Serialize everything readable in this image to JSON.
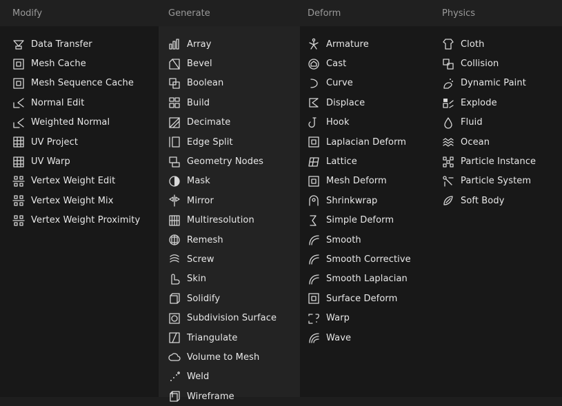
{
  "columns": [
    {
      "title": "Modify",
      "items": [
        {
          "label": "Data Transfer",
          "icon": "data-transfer-icon"
        },
        {
          "label": "Mesh Cache",
          "icon": "mesh-cache-icon"
        },
        {
          "label": "Mesh Sequence Cache",
          "icon": "mesh-sequence-cache-icon"
        },
        {
          "label": "Normal Edit",
          "icon": "normal-edit-icon"
        },
        {
          "label": "Weighted Normal",
          "icon": "weighted-normal-icon"
        },
        {
          "label": "UV Project",
          "icon": "uv-project-icon"
        },
        {
          "label": "UV Warp",
          "icon": "uv-warp-icon"
        },
        {
          "label": "Vertex Weight Edit",
          "icon": "vertex-weight-edit-icon"
        },
        {
          "label": "Vertex Weight Mix",
          "icon": "vertex-weight-mix-icon"
        },
        {
          "label": "Vertex Weight Proximity",
          "icon": "vertex-weight-proximity-icon"
        }
      ]
    },
    {
      "title": "Generate",
      "items": [
        {
          "label": "Array",
          "icon": "array-icon"
        },
        {
          "label": "Bevel",
          "icon": "bevel-icon"
        },
        {
          "label": "Boolean",
          "icon": "boolean-icon"
        },
        {
          "label": "Build",
          "icon": "build-icon"
        },
        {
          "label": "Decimate",
          "icon": "decimate-icon"
        },
        {
          "label": "Edge Split",
          "icon": "edge-split-icon"
        },
        {
          "label": "Geometry Nodes",
          "icon": "geometry-nodes-icon"
        },
        {
          "label": "Mask",
          "icon": "mask-icon"
        },
        {
          "label": "Mirror",
          "icon": "mirror-icon"
        },
        {
          "label": "Multiresolution",
          "icon": "multiresolution-icon"
        },
        {
          "label": "Remesh",
          "icon": "remesh-icon"
        },
        {
          "label": "Screw",
          "icon": "screw-icon"
        },
        {
          "label": "Skin",
          "icon": "skin-icon"
        },
        {
          "label": "Solidify",
          "icon": "solidify-icon"
        },
        {
          "label": "Subdivision Surface",
          "icon": "subdivision-surface-icon"
        },
        {
          "label": "Triangulate",
          "icon": "triangulate-icon"
        },
        {
          "label": "Volume to Mesh",
          "icon": "volume-to-mesh-icon"
        },
        {
          "label": "Weld",
          "icon": "weld-icon"
        },
        {
          "label": "Wireframe",
          "icon": "wireframe-icon"
        }
      ]
    },
    {
      "title": "Deform",
      "items": [
        {
          "label": "Armature",
          "icon": "armature-icon"
        },
        {
          "label": "Cast",
          "icon": "cast-icon"
        },
        {
          "label": "Curve",
          "icon": "curve-icon"
        },
        {
          "label": "Displace",
          "icon": "displace-icon"
        },
        {
          "label": "Hook",
          "icon": "hook-icon"
        },
        {
          "label": "Laplacian Deform",
          "icon": "laplacian-deform-icon"
        },
        {
          "label": "Lattice",
          "icon": "lattice-icon"
        },
        {
          "label": "Mesh Deform",
          "icon": "mesh-deform-icon"
        },
        {
          "label": "Shrinkwrap",
          "icon": "shrinkwrap-icon"
        },
        {
          "label": "Simple Deform",
          "icon": "simple-deform-icon"
        },
        {
          "label": "Smooth",
          "icon": "smooth-icon"
        },
        {
          "label": "Smooth Corrective",
          "icon": "smooth-corrective-icon"
        },
        {
          "label": "Smooth Laplacian",
          "icon": "smooth-laplacian-icon"
        },
        {
          "label": "Surface Deform",
          "icon": "surface-deform-icon"
        },
        {
          "label": "Warp",
          "icon": "warp-icon"
        },
        {
          "label": "Wave",
          "icon": "wave-icon"
        }
      ]
    },
    {
      "title": "Physics",
      "items": [
        {
          "label": "Cloth",
          "icon": "cloth-icon"
        },
        {
          "label": "Collision",
          "icon": "collision-icon"
        },
        {
          "label": "Dynamic Paint",
          "icon": "dynamic-paint-icon"
        },
        {
          "label": "Explode",
          "icon": "explode-icon"
        },
        {
          "label": "Fluid",
          "icon": "fluid-icon"
        },
        {
          "label": "Ocean",
          "icon": "ocean-icon"
        },
        {
          "label": "Particle Instance",
          "icon": "particle-instance-icon"
        },
        {
          "label": "Particle System",
          "icon": "particle-system-icon"
        },
        {
          "label": "Soft Body",
          "icon": "soft-body-icon"
        }
      ]
    }
  ],
  "colors": {
    "background": "#181818",
    "header": "#202020",
    "generate_column": "#252525",
    "text": "#e8e8e8",
    "heading": "#9a9a9a",
    "icon": "#d8d8d8"
  }
}
